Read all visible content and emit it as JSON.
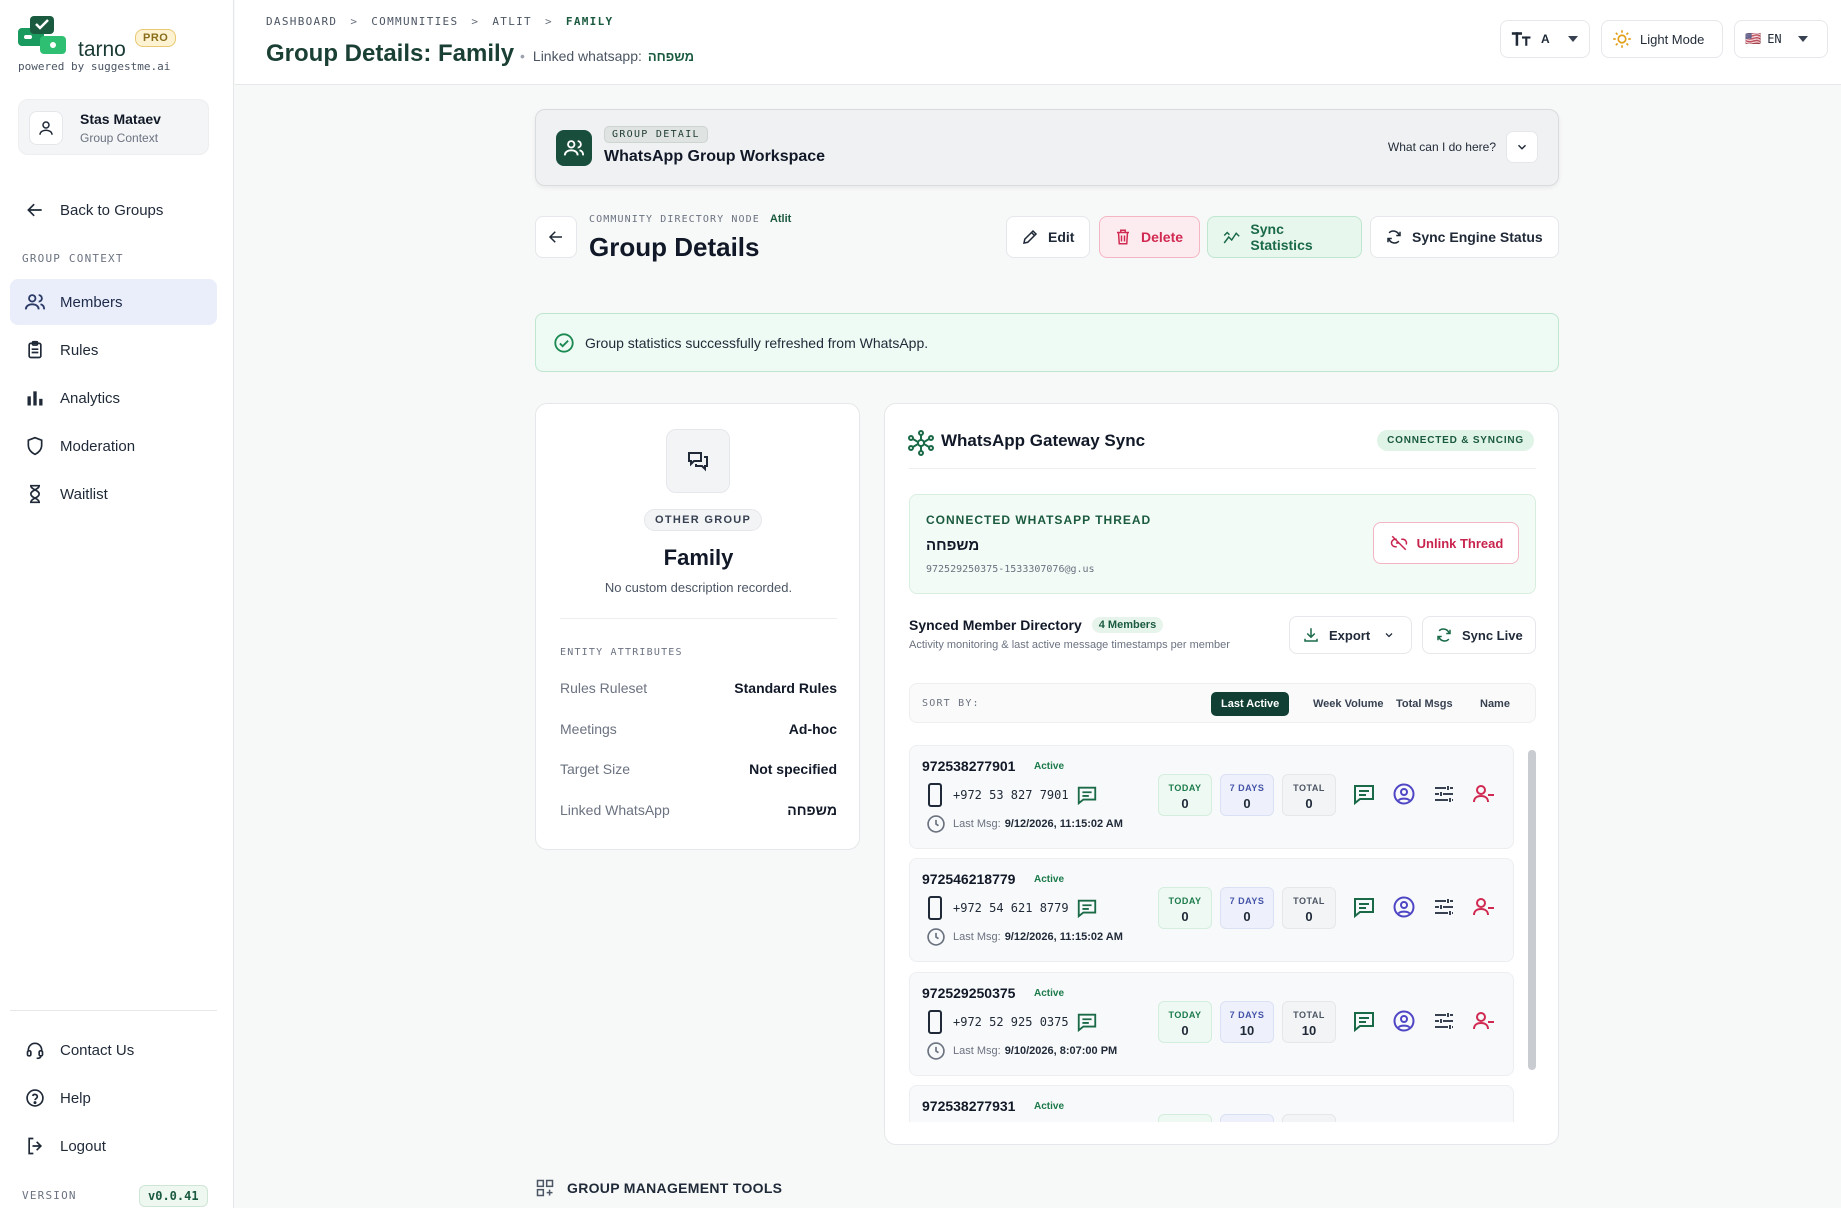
{
  "sidebar": {
    "brand": "tarno",
    "pro_badge": "PRO",
    "powered_by": "powered by suggestme.ai",
    "user": {
      "name": "Stas Mataev",
      "context": "Group Context"
    },
    "back": "Back to Groups",
    "section_label": "GROUP CONTEXT",
    "items": [
      {
        "label": "Members",
        "icon": "users-icon",
        "active": true
      },
      {
        "label": "Rules",
        "icon": "clipboard-icon"
      },
      {
        "label": "Analytics",
        "icon": "bar-chart-icon"
      },
      {
        "label": "Moderation",
        "icon": "shield-icon"
      },
      {
        "label": "Waitlist",
        "icon": "hourglass-icon"
      }
    ],
    "bottom": [
      {
        "label": "Contact Us",
        "icon": "headset-icon"
      },
      {
        "label": "Help",
        "icon": "help-circle-icon"
      },
      {
        "label": "Logout",
        "icon": "logout-icon"
      }
    ],
    "version_label": "VERSION",
    "version": "v0.0.41"
  },
  "header": {
    "breadcrumbs": [
      "DASHBOARD",
      "COMMUNITIES",
      "ATLIT",
      "FAMILY"
    ],
    "title": "Group Details: Family",
    "linked_label": "Linked whatsapp:",
    "linked_value": "משפחה",
    "font_size_label": "A",
    "theme_label": "Light Mode",
    "language": "EN",
    "flag": "🇺🇸"
  },
  "workspace": {
    "tag": "GROUP DETAIL",
    "title": "WhatsApp Group Workspace",
    "help": "What can I do here?"
  },
  "details_header": {
    "node_label": "COMMUNITY DIRECTORY NODE",
    "community": "Atlit",
    "title": "Group Details",
    "actions": {
      "edit": "Edit",
      "delete": "Delete",
      "sync_stats": "Sync Statistics",
      "sync_engine": "Sync Engine Status"
    }
  },
  "alert": {
    "message": "Group statistics successfully refreshed from WhatsApp."
  },
  "group_card": {
    "type": "OTHER GROUP",
    "name": "Family",
    "description": "No custom description recorded.",
    "attributes_label": "ENTITY ATTRIBUTES",
    "attributes": [
      {
        "key": "Rules Ruleset",
        "value": "Standard Rules"
      },
      {
        "key": "Meetings",
        "value": "Ad-hoc"
      },
      {
        "key": "Target Size",
        "value": "Not specified"
      },
      {
        "key": "Linked WhatsApp",
        "value": "משפחה"
      }
    ]
  },
  "sync": {
    "title": "WhatsApp Gateway Sync",
    "status": "CONNECTED & SYNCING",
    "thread_label": "CONNECTED WHATSAPP THREAD",
    "thread_name": "משפחה",
    "thread_jid": "972529250375-1533307076@g.us",
    "unlink": "Unlink Thread",
    "directory_title": "Synced Member Directory",
    "member_count": "4 Members",
    "directory_sub": "Activity monitoring & last active message timestamps per member",
    "export": "Export",
    "sync_live": "Sync Live",
    "sort_label": "SORT BY:",
    "sort_options": [
      "Last Active",
      "Week Volume",
      "Total Msgs",
      "Name"
    ],
    "stat_labels": {
      "today": "TODAY",
      "week": "7 DAYS",
      "total": "TOTAL"
    },
    "last_msg_label": "Last Msg:",
    "members": [
      {
        "id": "972538277901",
        "status": "Active",
        "phone": "+972 53 827 7901",
        "last_msg": "9/12/2026, 11:15:02 AM",
        "today": "0",
        "week": "0",
        "total": "0"
      },
      {
        "id": "972546218779",
        "status": "Active",
        "phone": "+972 54 621 8779",
        "last_msg": "9/12/2026, 11:15:02 AM",
        "today": "0",
        "week": "0",
        "total": "0"
      },
      {
        "id": "972529250375",
        "status": "Active",
        "phone": "+972 52 925 0375",
        "last_msg": "9/10/2026, 8:07:00 PM",
        "today": "0",
        "week": "10",
        "total": "10"
      },
      {
        "id": "972538277931",
        "status": "Active",
        "phone": "",
        "last_msg": "",
        "today": "",
        "week": "",
        "total": ""
      }
    ]
  },
  "tools": {
    "title": "GROUP MANAGEMENT TOOLS"
  }
}
